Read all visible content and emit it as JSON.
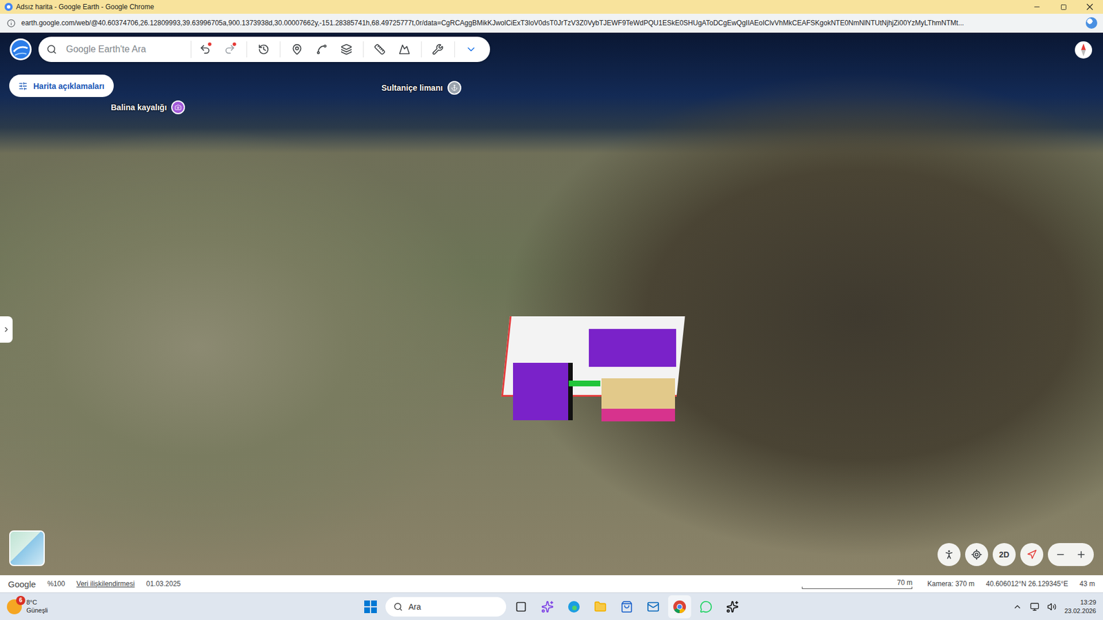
{
  "window": {
    "title": "Adsız harita - Google Earth - Google Chrome"
  },
  "browser": {
    "url": "earth.google.com/web/@40.60374706,26.12809993,39.63996705a,900.1373938d,30.00007662y,-151.28385741h,68.49725777t,0r/data=CgRCAggBMikKJwolCiExT3loV0dsT0JrTzV3Z0VybTJEWF9TeWdPQU1ESkE0SHUgAToDCgEwQgIIAEoIClvVhMkCEAFSKgokNTE0NmNlNTUtNjhjZi00YzMyLThmNTMt..."
  },
  "earth": {
    "search_placeholder": "Google Earth'te Ara",
    "legend_button": "Harita açıklamaları",
    "places": [
      {
        "label": "Sultaniçe limanı",
        "color": "#9aa3ad"
      },
      {
        "label": "Balina kayalığı",
        "color": "#a259d9"
      }
    ],
    "view_button": "2D"
  },
  "status_bar": {
    "brand": "Google",
    "zoom": "%100",
    "attribution": "Veri ilişkilendirmesi",
    "imagery_date": "01.03.2025",
    "scale": "70 m",
    "camera": "Kamera: 370 m",
    "coordinates": "40.606012°N 26.129345°E",
    "elevation": "43 m"
  },
  "taskbar": {
    "weather": {
      "temp": "8°C",
      "condition": "Güneşli",
      "badge": "6"
    },
    "search_placeholder": "Ara",
    "time": "13:29",
    "date": "23.02.2026"
  }
}
